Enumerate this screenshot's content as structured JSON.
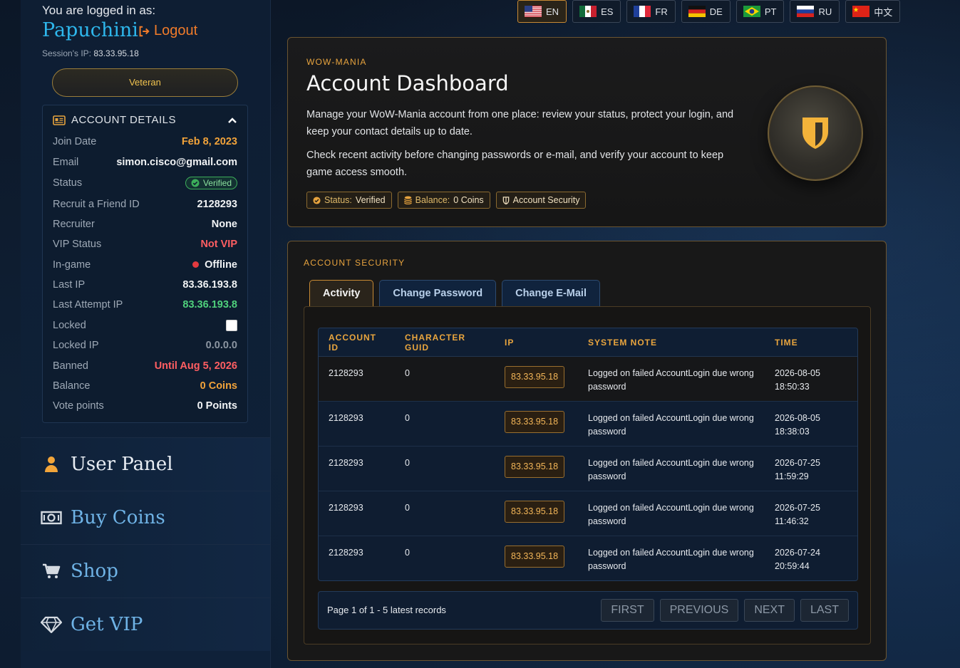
{
  "user": {
    "logged_in_label": "You are logged in as:",
    "name": "Papuchini",
    "logout_label": "Logout",
    "session_ip_label": "Session's IP:",
    "session_ip": "83.33.95.18",
    "rank": "Veteran"
  },
  "account_details": {
    "title": "ACCOUNT DETAILS",
    "rows": [
      {
        "key": "Join Date",
        "value": "Feb 8, 2023"
      },
      {
        "key": "Email",
        "value": "simon.cisco@gmail.com"
      },
      {
        "key": "Status",
        "value": "Verified"
      },
      {
        "key": "Recruit a Friend ID",
        "value": "2128293"
      },
      {
        "key": "Recruiter",
        "value": "None"
      },
      {
        "key": "VIP Status",
        "value": "Not VIP"
      },
      {
        "key": "In-game",
        "value": "Offline"
      },
      {
        "key": "Last IP",
        "value": "83.36.193.8"
      },
      {
        "key": "Last Attempt IP",
        "value": "83.36.193.8"
      },
      {
        "key": "Locked",
        "value": ""
      },
      {
        "key": "Locked IP",
        "value": "0.0.0.0"
      },
      {
        "key": "Banned",
        "value": "Until Aug 5, 2026"
      },
      {
        "key": "Balance",
        "value": "0 Coins"
      },
      {
        "key": "Vote points",
        "value": "0 Points"
      }
    ]
  },
  "nav": {
    "user_panel": "User Panel",
    "buy_coins": "Buy Coins",
    "shop": "Shop",
    "get_vip": "Get VIP"
  },
  "languages": [
    {
      "code": "EN",
      "active": true
    },
    {
      "code": "ES"
    },
    {
      "code": "FR"
    },
    {
      "code": "DE"
    },
    {
      "code": "PT"
    },
    {
      "code": "RU"
    },
    {
      "code": "中文"
    }
  ],
  "dashboard": {
    "eyebrow": "WOW-MANIA",
    "title": "Account Dashboard",
    "p1": "Manage your WoW-Mania account from one place: review your status, protect your login, and keep your contact details up to date.",
    "p2": "Check recent activity before changing passwords or e-mail, and verify your account to keep game access smooth.",
    "pill_status_key": "Status:",
    "pill_status_val": "Verified",
    "pill_balance_key": "Balance:",
    "pill_balance_val": "0 Coins",
    "pill_security": "Account Security"
  },
  "security": {
    "eyebrow": "ACCOUNT SECURITY",
    "tabs": [
      "Activity",
      "Change Password",
      "Change E-Mail"
    ],
    "columns": [
      "ACCOUNT ID",
      "CHARACTER GUID",
      "IP",
      "SYSTEM NOTE",
      "TIME"
    ],
    "rows": [
      {
        "account_id": "2128293",
        "guid": "0",
        "ip": "83.33.95.18",
        "note": "Logged on failed AccountLogin due wrong password",
        "date": "2026-08-05",
        "time": "18:50:33"
      },
      {
        "account_id": "2128293",
        "guid": "0",
        "ip": "83.33.95.18",
        "note": "Logged on failed AccountLogin due wrong password",
        "date": "2026-08-05",
        "time": "18:38:03"
      },
      {
        "account_id": "2128293",
        "guid": "0",
        "ip": "83.33.95.18",
        "note": "Logged on failed AccountLogin due wrong password",
        "date": "2026-07-25",
        "time": "11:59:29"
      },
      {
        "account_id": "2128293",
        "guid": "0",
        "ip": "83.33.95.18",
        "note": "Logged on failed AccountLogin due wrong password",
        "date": "2026-07-25",
        "time": "11:46:32"
      },
      {
        "account_id": "2128293",
        "guid": "0",
        "ip": "83.33.95.18",
        "note": "Logged on failed AccountLogin due wrong password",
        "date": "2026-07-24",
        "time": "20:59:44"
      }
    ],
    "pager_info": "Page 1 of 1 - 5 latest records",
    "pager_first": "FIRST",
    "pager_prev": "PREVIOUS",
    "pager_next": "NEXT",
    "pager_last": "LAST"
  },
  "colors": {
    "accent": "#e7a33e",
    "username": "#2eb7ec",
    "logout": "#f07b2a",
    "danger": "#ff5e62",
    "success": "#4fd17c"
  }
}
